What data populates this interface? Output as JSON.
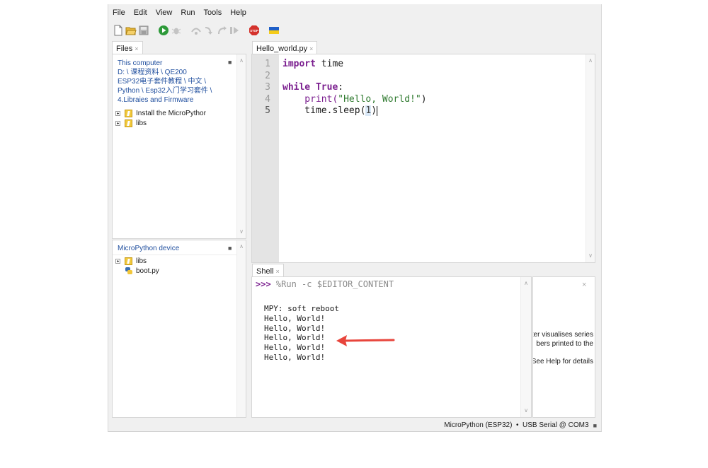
{
  "menu": [
    "File",
    "Edit",
    "View",
    "Run",
    "Tools",
    "Help"
  ],
  "toolbar": {
    "icons": [
      "new-file-icon",
      "open-folder-icon",
      "save-icon",
      "run-icon",
      "debug-icon",
      "step-over-icon",
      "step-into-icon",
      "step-out-icon",
      "resume-icon",
      "stop-icon",
      "ukraine-flag-icon"
    ],
    "stop_label": "STOP"
  },
  "files_panel": {
    "tab_label": "Files",
    "computer_path": [
      "This computer",
      "D: \\ 课程资料 \\ QE200",
      "ESP32电子套件教程 \\ 中文 \\",
      "Python \\ Esp32入门学习套件 \\",
      "4.Libraies and Firmware"
    ],
    "computer_items": [
      "Install the MicroPythor",
      "libs"
    ],
    "device_title": "MicroPython device",
    "device_items": [
      "libs",
      "boot.py"
    ]
  },
  "editor": {
    "tab_label": "Hello_world.py",
    "line_numbers": [
      "1",
      "2",
      "3",
      "4",
      "5"
    ],
    "lines": {
      "l1_kw": "import",
      "l1_rest": " time",
      "l3_kw": "while",
      "l3_kw2": "True",
      "l3_rest": ":",
      "l4_fn": "    print(",
      "l4_str": "\"Hello, World!\"",
      "l4_close": ")",
      "l5_pre": "    time.sleep(",
      "l5_arg": "1",
      "l5_close": ")"
    }
  },
  "shell": {
    "tab_label": "Shell",
    "prompt": ">>>",
    "command": "%Run -c $EDITOR_CONTENT",
    "output": [
      "MPY: soft reboot",
      "Hello, World!",
      "Hello, World!",
      "Hello, World!",
      "Hello, World!",
      "Hello, World!"
    ]
  },
  "plotter_hint": {
    "lines": [
      "tter visualises series",
      "bers printed to the",
      "See Help for details"
    ]
  },
  "status_bar": {
    "text": "MicroPython (ESP32)  •  USB Serial @ COM3"
  },
  "colors": {
    "annotation_arrow": "#e8453c",
    "keyword": "#7b1f8f",
    "string": "#2f7a2f",
    "link": "#1f4e9e"
  }
}
